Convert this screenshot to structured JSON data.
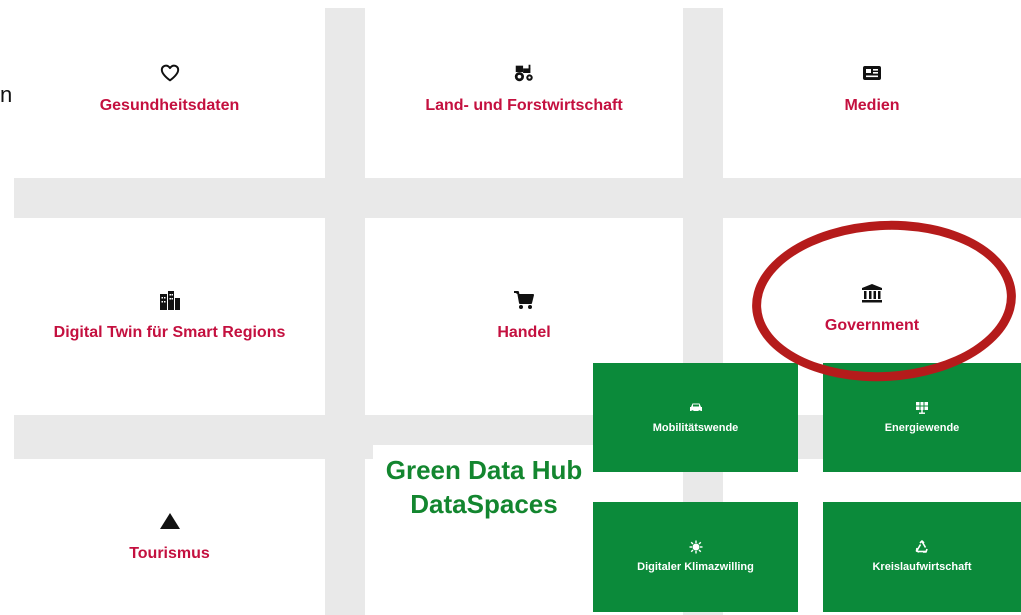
{
  "tiles": {
    "gesundheit": {
      "label": "Gesundheitsdaten",
      "icon": "heart-icon"
    },
    "land": {
      "label": "Land- und Forstwirtschaft",
      "icon": "tractor-icon"
    },
    "medien": {
      "label": "Medien",
      "icon": "newspaper-icon"
    },
    "digital_twin": {
      "label": "Digital Twin für Smart Regions",
      "icon": "city-icon"
    },
    "handel": {
      "label": "Handel",
      "icon": "shopping-cart-icon"
    },
    "government": {
      "label": "Government",
      "icon": "landmark-icon"
    },
    "tourismus": {
      "label": "Tourismus",
      "icon": "mountain-icon"
    }
  },
  "green_tiles": {
    "mobilitaet": {
      "label": "Mobilitätswende",
      "icon": "car-icon"
    },
    "energie": {
      "label": "Energiewende",
      "icon": "solar-panel-icon"
    },
    "klima": {
      "label": "Digitaler Klimazwilling",
      "icon": "virus-icon"
    },
    "kreislauf": {
      "label": "Kreislaufwirtschaft",
      "icon": "recycle-icon"
    }
  },
  "hub": {
    "line1": "Green Data Hub",
    "line2": "DataSpaces"
  },
  "edge_text": "n",
  "colors": {
    "label_red": "#c4103f",
    "green": "#0b8a3a",
    "hub_green": "#13862f",
    "ring_red": "#b51b1b",
    "gray": "#e9e9e9"
  }
}
